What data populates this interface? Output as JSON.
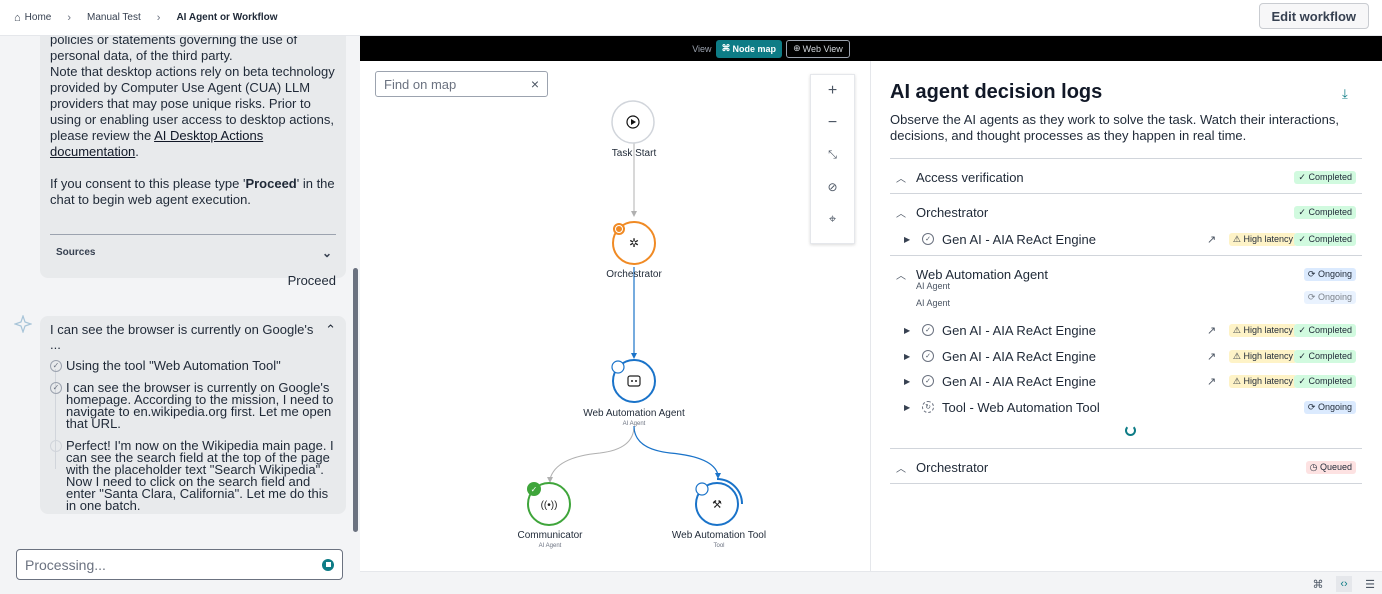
{
  "breadcrumb": {
    "home": "Home",
    "manual": "Manual Test",
    "current": "AI Agent or Workflow"
  },
  "edit_button": "Edit workflow",
  "chat": {
    "consent_line1": "policies or statements governing the use of personal data, of the third party.",
    "consent_line2_pre": "Note that desktop actions rely on beta technology provided by Computer Use Agent (CUA) LLM providers that may pose unique risks. Prior to using or enabling user access to desktop actions, please review the ",
    "consent_link": "AI Desktop Actions documentation",
    "consent_line2_post": ".",
    "consent_prompt_pre": "If you consent to this please type '",
    "consent_prompt_word": "Proceed",
    "consent_prompt_post": "' in the chat to begin web agent execution.",
    "sources_label": "Sources",
    "user_message": "Proceed",
    "agent_header": "I can see the browser is currently on Google's ...",
    "steps": [
      "Using the tool \"Web Automation Tool\"",
      "I can see the browser is currently on Google's homepage. According to the mission, I need to navigate to en.wikipedia.org first. Let me open that URL.",
      "Perfect! I'm now on the Wikipedia main page. I can see the search field at the top of the page with the placeholder text \"Search Wikipedia\". Now I need to click on the search field and enter \"Santa Clara, California\". Let me do this in one batch."
    ],
    "input_placeholder": "Processing..."
  },
  "view_toggle": {
    "label": "View",
    "node_map": "Node map",
    "web_view": "Web View"
  },
  "map": {
    "find_placeholder": "Find on map",
    "nodes": {
      "task_start": "Task Start",
      "orchestrator": "Orchestrator",
      "web_agent": "Web Automation Agent",
      "web_agent_sub": "AI Agent",
      "communicator": "Communicator",
      "communicator_sub": "AI Agent",
      "web_tool": "Web Automation Tool",
      "web_tool_sub": "Tool"
    }
  },
  "logs": {
    "title": "AI agent decision logs",
    "description": "Observe the AI agents as they work to solve the task. Watch their interactions, decisions, and thought processes as they happen in real time.",
    "sections": {
      "access": {
        "label": "Access verification",
        "status": "Completed"
      },
      "orch1": {
        "label": "Orchestrator",
        "status": "Completed"
      },
      "orch1_item": {
        "label": "Gen AI - AIA ReAct Engine",
        "latency": "High latency",
        "status": "Completed"
      },
      "web": {
        "label": "Web Automation Agent",
        "sub": "AI Agent",
        "sub2": "AI Agent",
        "status": "Ongoing",
        "status_ghost": "Ongoing"
      },
      "web_items": [
        {
          "label": "Gen AI - AIA ReAct Engine",
          "latency": "High latency",
          "status": "Completed"
        },
        {
          "label": "Gen AI - AIA ReAct Engine",
          "latency": "High latency",
          "status": "Completed"
        },
        {
          "label": "Gen AI - AIA ReAct Engine",
          "latency": "High latency",
          "status": "Completed"
        }
      ],
      "web_tool_item": {
        "label": "Tool - Web Automation Tool",
        "status": "Ongoing"
      },
      "orch2": {
        "label": "Orchestrator",
        "status": "Queued"
      }
    }
  },
  "colors": {
    "accent": "#0e7c86",
    "orchestrator": "#f08a24",
    "agent_blue": "#1a73c9",
    "communicator_green": "#3fa53b"
  }
}
